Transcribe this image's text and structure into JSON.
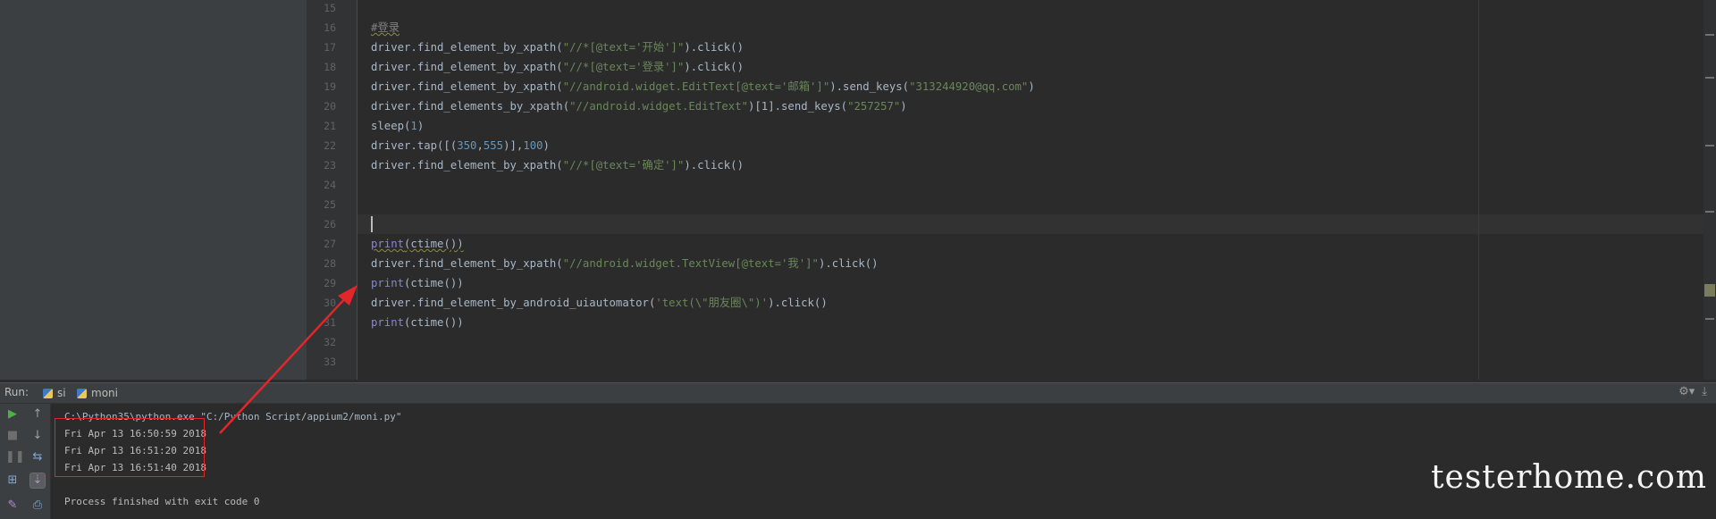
{
  "editor": {
    "lines": [
      {
        "no": "15",
        "segments": []
      },
      {
        "no": "16",
        "segments": [
          {
            "t": "#登录",
            "c": "c-comment squiggle"
          }
        ]
      },
      {
        "no": "17",
        "segments": [
          {
            "t": "driver.find_element_by_xpath(",
            "c": "c-default"
          },
          {
            "t": "\"//*[@text='开始']\"",
            "c": "c-str"
          },
          {
            "t": ").click()",
            "c": "c-default"
          }
        ]
      },
      {
        "no": "18",
        "segments": [
          {
            "t": "driver.find_element_by_xpath(",
            "c": "c-default"
          },
          {
            "t": "\"//*[@text='登录']\"",
            "c": "c-str"
          },
          {
            "t": ").click()",
            "c": "c-default"
          }
        ]
      },
      {
        "no": "19",
        "segments": [
          {
            "t": "driver.find_element_by_xpath(",
            "c": "c-default"
          },
          {
            "t": "\"//android.widget.EditText[@text='邮箱']\"",
            "c": "c-str"
          },
          {
            "t": ").send_keys(",
            "c": "c-default"
          },
          {
            "t": "\"313244920@qq.com\"",
            "c": "c-str"
          },
          {
            "t": ")",
            "c": "c-default"
          }
        ]
      },
      {
        "no": "20",
        "segments": [
          {
            "t": "driver.find_elements_by_xpath(",
            "c": "c-default"
          },
          {
            "t": "\"//android.widget.EditText\"",
            "c": "c-str"
          },
          {
            "t": ")[1].send_keys(",
            "c": "c-default"
          },
          {
            "t": "\"257257\"",
            "c": "c-str"
          },
          {
            "t": ")",
            "c": "c-default"
          }
        ]
      },
      {
        "no": "21",
        "segments": [
          {
            "t": "sleep(",
            "c": "c-default"
          },
          {
            "t": "1",
            "c": "c-num"
          },
          {
            "t": ")",
            "c": "c-default"
          }
        ]
      },
      {
        "no": "22",
        "segments": [
          {
            "t": "driver.tap([(",
            "c": "c-default"
          },
          {
            "t": "350",
            "c": "c-num"
          },
          {
            "t": ",",
            "c": "c-default"
          },
          {
            "t": "555",
            "c": "c-num"
          },
          {
            "t": ")],",
            "c": "c-default"
          },
          {
            "t": "100",
            "c": "c-num"
          },
          {
            "t": ")",
            "c": "c-default"
          }
        ]
      },
      {
        "no": "23",
        "segments": [
          {
            "t": "driver.find_element_by_xpath(",
            "c": "c-default"
          },
          {
            "t": "\"//*[@text='确定']\"",
            "c": "c-str"
          },
          {
            "t": ").click()",
            "c": "c-default"
          }
        ]
      },
      {
        "no": "24",
        "segments": []
      },
      {
        "no": "25",
        "segments": []
      },
      {
        "no": "26",
        "segments": []
      },
      {
        "no": "27",
        "segments": [
          {
            "t": "print",
            "c": "c-builtin squiggle"
          },
          {
            "t": "(ctime())",
            "c": "c-default squiggle"
          }
        ]
      },
      {
        "no": "28",
        "segments": [
          {
            "t": "driver.find_element_by_xpath(",
            "c": "c-default"
          },
          {
            "t": "\"//android.widget.TextView[@text='我']\"",
            "c": "c-str"
          },
          {
            "t": ").click()",
            "c": "c-default"
          }
        ]
      },
      {
        "no": "29",
        "segments": [
          {
            "t": "print",
            "c": "c-builtin"
          },
          {
            "t": "(ctime())",
            "c": "c-default"
          }
        ]
      },
      {
        "no": "30",
        "segments": [
          {
            "t": "driver.find_element_by_android_uiautomator(",
            "c": "c-default"
          },
          {
            "t": "'text(\\\"朋友圈\\\")'",
            "c": "c-str"
          },
          {
            "t": ").click()",
            "c": "c-default"
          }
        ]
      },
      {
        "no": "31",
        "segments": [
          {
            "t": "print",
            "c": "c-builtin"
          },
          {
            "t": "(ctime())",
            "c": "c-default"
          }
        ]
      },
      {
        "no": "32",
        "segments": []
      },
      {
        "no": "33",
        "segments": []
      }
    ],
    "caret_line": "26"
  },
  "run": {
    "label": "Run:",
    "tabs": [
      {
        "label": "si",
        "active": false
      },
      {
        "label": "moni",
        "active": true
      }
    ]
  },
  "console": {
    "command": "C:\\Python35\\python.exe \"C:/Python Script/appium2/moni.py\"",
    "outputs": [
      "Fri Apr 13 16:50:59 2018",
      "Fri Apr 13 16:51:20 2018",
      "Fri Apr 13 16:51:40 2018"
    ],
    "exit_message": "Process finished with exit code 0"
  },
  "watermark": "testerhome.com",
  "colors": {
    "annotation_red": "#e2262a",
    "editor_bg": "#2b2b2b"
  }
}
